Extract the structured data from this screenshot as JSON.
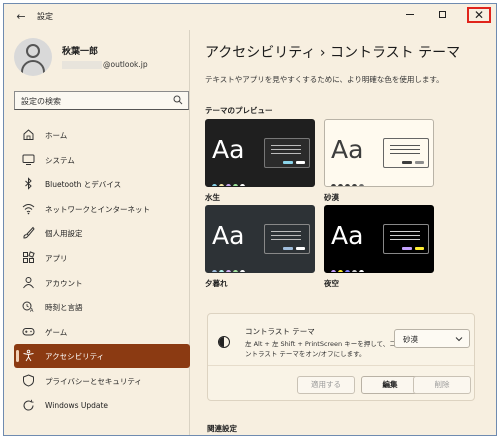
{
  "app": {
    "title": "設定",
    "back_label": "←",
    "close_label": "✕"
  },
  "user": {
    "name": "秋葉一郎",
    "email_suffix": "@outlook.jp"
  },
  "search": {
    "placeholder": "設定の検索"
  },
  "nav": {
    "items": [
      {
        "label": "ホーム",
        "icon": "home-icon"
      },
      {
        "label": "システム",
        "icon": "monitor-icon"
      },
      {
        "label": "Bluetooth とデバイス",
        "icon": "bluetooth-icon"
      },
      {
        "label": "ネットワークとインターネット",
        "icon": "wifi-icon"
      },
      {
        "label": "個人用設定",
        "icon": "brush-icon"
      },
      {
        "label": "アプリ",
        "icon": "apps-icon"
      },
      {
        "label": "アカウント",
        "icon": "account-icon"
      },
      {
        "label": "時刻と言語",
        "icon": "time-language-icon"
      },
      {
        "label": "ゲーム",
        "icon": "gamepad-icon"
      },
      {
        "label": "アクセシビリティ",
        "icon": "accessibility-icon",
        "active": true
      },
      {
        "label": "プライバシーとセキュリティ",
        "icon": "shield-icon"
      },
      {
        "label": "Windows Update",
        "icon": "update-icon"
      }
    ]
  },
  "main": {
    "title": "アクセシビリティ  ›  コントラスト テーマ",
    "description": "テキストやアプリを見やすくするために、より明確な色を使用します。",
    "preview_heading": "テーマのプレビュー",
    "themes": [
      {
        "name": "水生",
        "bg": "#1f1f1f",
        "fg": "#ffffff",
        "accent": "#8ad4ea"
      },
      {
        "name": "砂漠",
        "bg": "#fffaef",
        "fg": "#3d3d3d",
        "accent": "#3d3d3d"
      },
      {
        "name": "夕暮れ",
        "bg": "#2d3236",
        "fg": "#ffffff",
        "accent": "#a1bfde"
      },
      {
        "name": "夜空",
        "bg": "#000000",
        "fg": "#ffffff",
        "accent": "#c5a2ff"
      }
    ],
    "contrast_card": {
      "title": "コントラスト テーマ",
      "description": "左 Alt + 左 Shift + PrintScreen キーを押して、コントラスト テーマをオン/オフにします。",
      "selected_value": "砂漠",
      "buttons": {
        "apply": "適用する",
        "edit": "編集",
        "delete": "削除"
      }
    },
    "related_heading": "関連設定"
  },
  "colors": {
    "window_bg": "#f7efe0",
    "active_nav": "#8b3a12",
    "close_highlight": "#e0241b"
  }
}
